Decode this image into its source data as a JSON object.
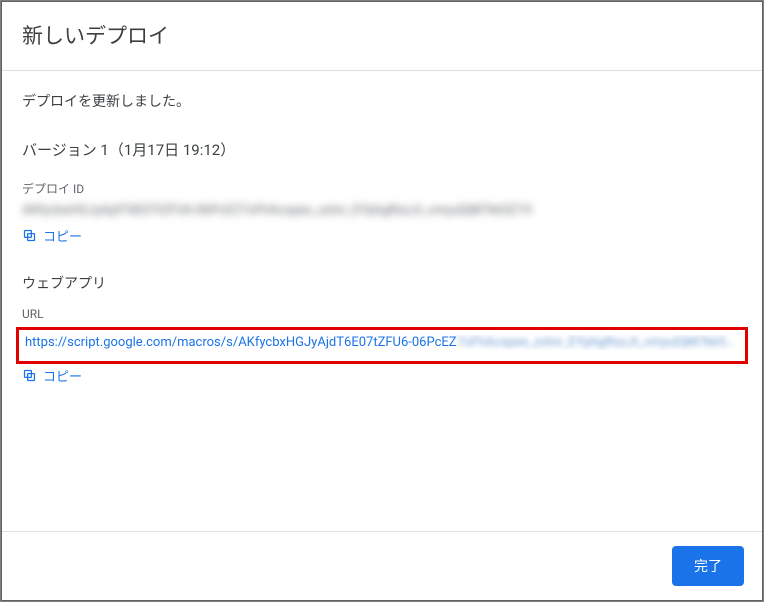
{
  "dialog": {
    "title": "新しいデプロイ",
    "message": "デプロイを更新しました。",
    "version_line": "バージョン 1（1月17日 19:12）",
    "deploy": {
      "label": "デプロイ ID",
      "value": "AKfycbxHGJyAjdT6E07tZFU6-06PcEZ7oFhAcspex_zxtnr_EYphgRszJt_vmyuDjM7kk5Z19",
      "copy_label": "コピー"
    },
    "webapp": {
      "heading": "ウェブアプリ",
      "url_label": "URL",
      "url_visible": "https://script.google.com/macros/s/AKfycbxHGJyAjdT6E07tZFU6-06PcEZ",
      "url_blurred": "7oFhAcspex_zxtnr_EYphgRszJt_vmyuDjM7kk5…",
      "copy_label": "コピー"
    },
    "done_label": "完了"
  }
}
